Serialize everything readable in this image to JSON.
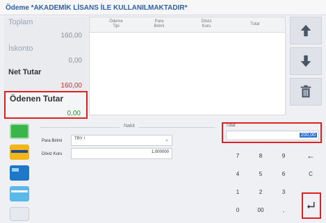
{
  "window": {
    "title": "Ödeme *AKADEMİK LİSANS İLE KULLANILMAKTADIR*"
  },
  "totals": {
    "toplam": {
      "label": "Toplam",
      "value": "160,00"
    },
    "iskonto": {
      "label": "İskonto",
      "value": "0,00"
    },
    "net": {
      "label": "Net Tutar",
      "value": "160,00"
    },
    "paid": {
      "label": "Ödenen Tutar",
      "value": "0,00"
    }
  },
  "payments_table": {
    "columns": [
      {
        "line1": "Ödeme",
        "line2": "Tipi"
      },
      {
        "line1": "Para",
        "line2": "Birimi"
      },
      {
        "line1": "Döviz",
        "line2": "Kuru"
      },
      {
        "line1": "Tutar",
        "line2": ""
      }
    ]
  },
  "side_buttons": [
    "arrow-up-icon",
    "arrow-down-icon",
    "trash-icon"
  ],
  "payment_types": [
    "cash-icon",
    "credit-card-icon",
    "debit-card-icon",
    "card-icon",
    "card-icon"
  ],
  "nakit": {
    "title": "Nakit",
    "currency_label": "Para Birimi",
    "currency_value": "TRY /",
    "rate_label": "Döviz Kuru",
    "rate_value": "1,000000"
  },
  "tutar": {
    "label": "Tutar",
    "value": "200,00"
  },
  "keypad": {
    "rows": [
      [
        "7",
        "8",
        "9",
        "←"
      ],
      [
        "4",
        "5",
        "6",
        "C"
      ],
      [
        "1",
        "2",
        "3",
        ""
      ],
      [
        "0",
        "00",
        ",",
        ""
      ]
    ],
    "enter": "enter-icon"
  },
  "colors": {
    "accent": "#2b5fa8",
    "highlight": "#e02020",
    "net_value": "#d62b2b",
    "paid_value": "#1aa11a",
    "selection": "#2d6fd0"
  }
}
